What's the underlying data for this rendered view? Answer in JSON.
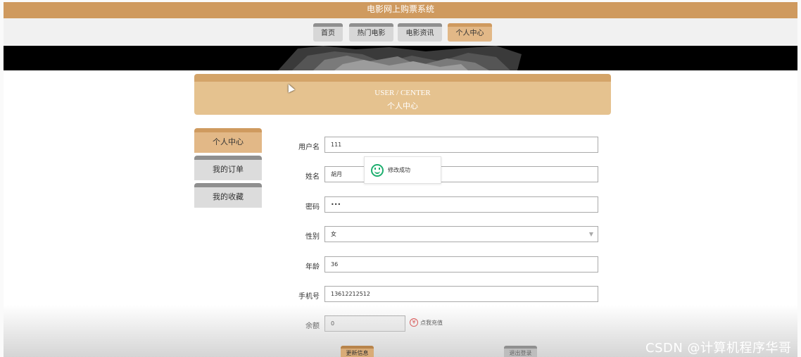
{
  "app": {
    "title": "电影网上购票系统"
  },
  "nav": {
    "items": [
      "首页",
      "热门电影",
      "电影资讯",
      "个人中心"
    ],
    "active": "个人中心"
  },
  "header": {
    "en": "USER / CENTER",
    "cn": "个人中心"
  },
  "sidebar": {
    "items": [
      "个人中心",
      "我的订单",
      "我的收藏"
    ],
    "active": "个人中心"
  },
  "form": {
    "username": {
      "label": "用户名",
      "value": "111"
    },
    "name": {
      "label": "姓名",
      "value": "胡月"
    },
    "password": {
      "label": "密码",
      "value": "•••"
    },
    "gender": {
      "label": "性别",
      "value": "女"
    },
    "age": {
      "label": "年龄",
      "value": "36"
    },
    "phone": {
      "label": "手机号",
      "value": "13612212512"
    },
    "balance": {
      "label": "余额",
      "value": "0",
      "recharge_label": "点我充值"
    }
  },
  "toast": {
    "message": "修改成功",
    "icon": "smile-icon"
  },
  "buttons": {
    "update": "更新信息",
    "logout": "退出登录"
  },
  "watermark": "CSDN @计算机程序华哥",
  "colors": {
    "brand": "#cf9a5f",
    "active_tab": "#e2b887",
    "inactive_tab": "#d7d7d7"
  }
}
